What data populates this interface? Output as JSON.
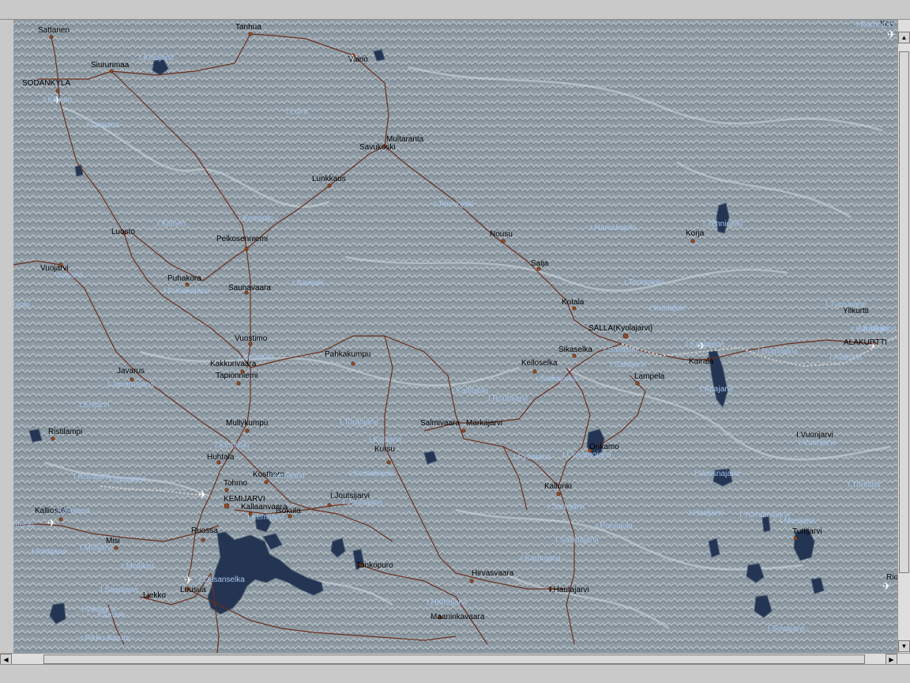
{
  "colors": {
    "terrain": "#8e9aa3",
    "water_body": "#243554",
    "road": "#6b2e1c",
    "railway": "#b7b7b7",
    "town_label": "#000000",
    "water_label": "#a9c6ec",
    "window_frame": "#c9c9c9"
  },
  "icons": {
    "airport": "airplane-icon",
    "town": "town-dot-icon",
    "scroll_up": "arrow-up-icon",
    "scroll_down": "arrow-down-icon",
    "scroll_left": "arrow-left-icon",
    "scroll_right": "arrow-right-icon"
  },
  "map": {
    "towns": [
      "Sattanen",
      "Tanhua",
      "Siurunmaa",
      "Vairio",
      "SODANKYLA",
      "Multaranta",
      "Savukoski",
      "Lunkkaus",
      "Luosto",
      "Pelkosenniemi",
      "Nousu",
      "Korja",
      "Saija",
      "Vuojarvi",
      "Puhakora",
      "Saunavaara",
      "Kotala",
      "Yllkurtti",
      "SALLA(Kyolajarvi)",
      "ALAKURTTI",
      "Vuostimo",
      "Sikaselka",
      "Pahkakumpu",
      "Kelloselka",
      "Kakkurivaara",
      "Kairala",
      "Lampela",
      "Javarus",
      "Tapionniemi",
      "Ristilampi",
      "Mullykumpu",
      "Salmivaara",
      "Markajarvi",
      "I.Vuorijarvi",
      "Onkamo",
      "Huhtala",
      "Kursu",
      "Kosthero",
      "Tohmo",
      "Kallunki",
      "Kalliosuka",
      "KEMIJARVI",
      "Kallaanvaara",
      "Isokula",
      "I.Joutsijarvi",
      "Misi",
      "Ruossa",
      "Tuttijarvi",
      "Tonkopuro",
      "Hirvasvaara",
      "Luusua",
      "Liekko",
      "I.Hautajarvi",
      "Maaninkavaara",
      "Kov",
      "Rio"
    ],
    "water_labels": [
      "r.Kelujarvi",
      "r.Kitinen",
      "r.Luiro",
      "r.Orajarvi",
      "r.Tenniojoki",
      "r.Kitinen",
      "r.Kemijoki",
      "r.Naruskajoki",
      "r.Tenniojoki",
      "Vuojarvi",
      "r.Savijoki",
      "r.Tenniojoki",
      "r.Kuolajoki",
      "I.Tunsajarvi",
      "I.Puhakojarvi",
      "r.Kemijoki",
      "r.Kuolajoki",
      "r.Sallajoki",
      "I.Kyolajarvi",
      "I.Nurmijarvi",
      "I.Alakorvi",
      "I.Sallajarvi",
      "I.Javarusjarvi",
      "r.Sotkajarka",
      "r.Kaitiojoki",
      "I.Apajarvi",
      "I.Enijarvi",
      "I.Ruuhijarvi",
      "I.Toranjarvi",
      "I.Kotijarvi",
      "I.Vuorijarvi",
      "I.Pyhajarvi",
      "I.Onkamojarvi",
      "I.Rovajarvi",
      "I.Hyvajarvi",
      "I.Kemijoki",
      "I.Kostaknjoki",
      "I.Vuosnajarvi",
      "r.Tuntsha",
      "I.Kemijarvi",
      "I.Joutsijarvi",
      "r.Sarnijarvi",
      "I.Hasijarvi",
      "I.Yurhamajarvi",
      "I.Masijarvi",
      "I.Kallojarvi",
      "I.Kemijarvi",
      "r.Porvojoki",
      "I.Pirttijarvi",
      "I.Misijarvi",
      "I.Savinajarvi",
      "r.Ossanselka",
      "r.Karhujarvi",
      "r.Mollikisi",
      "I.Saarijarvi",
      "I.Vikajarvi",
      "r.Sauvo",
      "I.Harhujarvi",
      "r.Pikku-Kaarni",
      "I.Sovajarvi",
      "I.Kuttujarvi",
      "r.Karhujoki",
      "njoki",
      "ittunki"
    ],
    "airports": [
      "sodankyla-airfield",
      "vairio-airfield",
      "kairala-airfield",
      "alakurtti-airfield",
      "kemijarvi-airfield",
      "luusua-airfield",
      "rio-airfield",
      "kov-airfield",
      "kalliosuka-airfield"
    ]
  }
}
